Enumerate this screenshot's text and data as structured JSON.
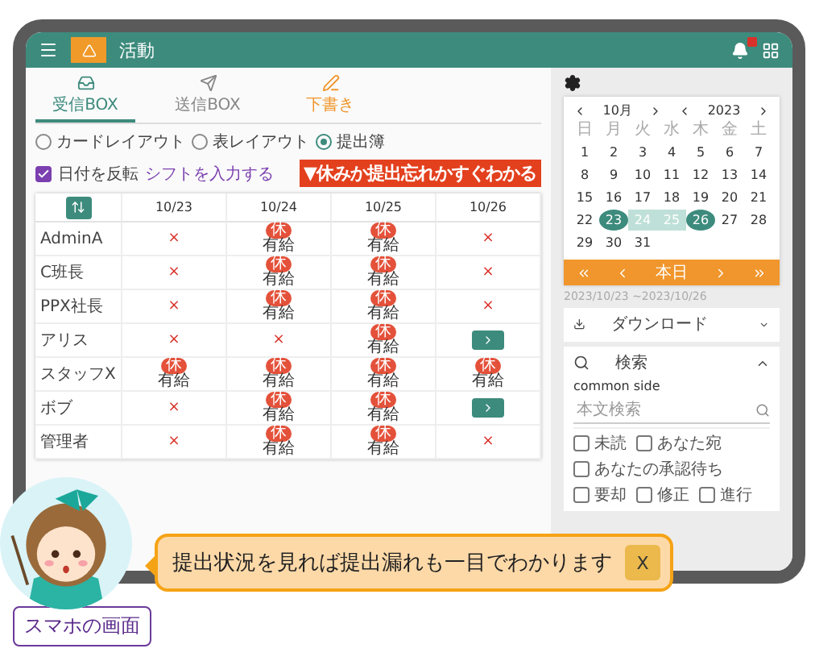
{
  "app_bar": {
    "title": "活動"
  },
  "tabs": [
    {
      "label": "受信BOX",
      "selected": true,
      "kind": "inbox"
    },
    {
      "label": "送信BOX",
      "selected": false,
      "kind": "outbox"
    },
    {
      "label": "下書き",
      "selected": false,
      "kind": "draft"
    }
  ],
  "layout_options": [
    {
      "label": "カードレイアウト",
      "selected": false
    },
    {
      "label": "表レイアウト",
      "selected": false
    },
    {
      "label": "提出簿",
      "selected": true
    }
  ],
  "reverse_dates": {
    "label": "日付を反転",
    "checked": true
  },
  "shift_link": "シフトを入力する",
  "banner": "▼休みか提出忘れかすぐわかる",
  "table": {
    "columns": [
      "10/23",
      "10/24",
      "10/25",
      "10/26"
    ],
    "rows": [
      {
        "name": "AdminA",
        "cells": [
          {
            "kind": "missing",
            "text": "×"
          },
          {
            "kind": "leave",
            "badge": "休",
            "label": "有給"
          },
          {
            "kind": "leave",
            "badge": "休",
            "label": "有給"
          },
          {
            "kind": "missing",
            "text": "×"
          }
        ]
      },
      {
        "name": "C班長",
        "cells": [
          {
            "kind": "missing",
            "text": "×"
          },
          {
            "kind": "leave",
            "badge": "休",
            "label": "有給"
          },
          {
            "kind": "leave",
            "badge": "休",
            "label": "有給"
          },
          {
            "kind": "missing",
            "text": "×"
          }
        ]
      },
      {
        "name": "PPX社長",
        "cells": [
          {
            "kind": "missing",
            "text": "×"
          },
          {
            "kind": "leave",
            "badge": "休",
            "label": "有給"
          },
          {
            "kind": "leave",
            "badge": "休",
            "label": "有給"
          },
          {
            "kind": "missing",
            "text": "×"
          }
        ]
      },
      {
        "name": "アリス",
        "cells": [
          {
            "kind": "missing",
            "text": "×"
          },
          {
            "kind": "missing",
            "text": "×"
          },
          {
            "kind": "leave",
            "badge": "休",
            "label": "有給"
          },
          {
            "kind": "action"
          }
        ]
      },
      {
        "name": "スタッフX",
        "cells": [
          {
            "kind": "leave",
            "badge": "休",
            "label": "有給"
          },
          {
            "kind": "leave",
            "badge": "休",
            "label": "有給"
          },
          {
            "kind": "leave",
            "badge": "休",
            "label": "有給"
          },
          {
            "kind": "leave",
            "badge": "休",
            "label": "有給"
          }
        ]
      },
      {
        "name": "ボブ",
        "cells": [
          {
            "kind": "missing",
            "text": "×"
          },
          {
            "kind": "leave",
            "badge": "休",
            "label": "有給"
          },
          {
            "kind": "leave",
            "badge": "休",
            "label": "有給"
          },
          {
            "kind": "action"
          }
        ]
      },
      {
        "name": "管理者",
        "cells": [
          {
            "kind": "missing",
            "text": "×"
          },
          {
            "kind": "leave",
            "badge": "休",
            "label": "有給"
          },
          {
            "kind": "leave",
            "badge": "休",
            "label": "有給"
          },
          {
            "kind": "missing",
            "text": "×"
          }
        ]
      }
    ]
  },
  "calendar": {
    "month": "10月",
    "year": "2023",
    "weekdays": [
      "日",
      "月",
      "火",
      "水",
      "木",
      "金",
      "土"
    ],
    "weeks": [
      [
        {
          "day": "1",
          "selected": false,
          "kind": "plain"
        },
        {
          "day": "2",
          "selected": false,
          "kind": "plain"
        },
        {
          "day": "3",
          "selected": false,
          "kind": "plain"
        },
        {
          "day": "4",
          "selected": false,
          "kind": "plain"
        },
        {
          "day": "5",
          "selected": false,
          "kind": "plain"
        },
        {
          "day": "6",
          "selected": false,
          "kind": "plain"
        },
        {
          "day": "7",
          "selected": false,
          "kind": "plain"
        }
      ],
      [
        {
          "day": "8",
          "selected": false,
          "kind": "plain"
        },
        {
          "day": "9",
          "selected": false,
          "kind": "plain"
        },
        {
          "day": "10",
          "selected": false,
          "kind": "plain"
        },
        {
          "day": "11",
          "selected": false,
          "kind": "plain"
        },
        {
          "day": "12",
          "selected": false,
          "kind": "plain"
        },
        {
          "day": "13",
          "selected": false,
          "kind": "plain"
        },
        {
          "day": "14",
          "selected": false,
          "kind": "plain"
        }
      ],
      [
        {
          "day": "15",
          "selected": false,
          "kind": "plain"
        },
        {
          "day": "16",
          "selected": false,
          "kind": "plain"
        },
        {
          "day": "17",
          "selected": false,
          "kind": "plain"
        },
        {
          "day": "18",
          "selected": false,
          "kind": "plain"
        },
        {
          "day": "19",
          "selected": false,
          "kind": "plain"
        },
        {
          "day": "20",
          "selected": false,
          "kind": "plain"
        },
        {
          "day": "21",
          "selected": false,
          "kind": "plain"
        }
      ],
      [
        {
          "day": "22",
          "selected": false,
          "kind": "plain"
        },
        {
          "day": "23",
          "selected": true,
          "kind": "edge"
        },
        {
          "day": "24",
          "selected": true,
          "kind": "inner"
        },
        {
          "day": "25",
          "selected": true,
          "kind": "inner"
        },
        {
          "day": "26",
          "selected": true,
          "kind": "edge"
        },
        {
          "day": "27",
          "selected": false,
          "kind": "plain"
        },
        {
          "day": "28",
          "selected": false,
          "kind": "plain"
        }
      ],
      [
        {
          "day": "29",
          "selected": false,
          "kind": "plain"
        },
        {
          "day": "30",
          "selected": false,
          "kind": "plain"
        },
        {
          "day": "31",
          "selected": false,
          "kind": "plain"
        }
      ]
    ],
    "today": "本日",
    "range": "2023/10/23 ~2023/10/26"
  },
  "download": {
    "label": "ダウンロード",
    "expanded": false
  },
  "search": {
    "label": "検索",
    "expanded": true,
    "scope": "common side",
    "placeholder": "本文検索",
    "filters": [
      {
        "label": "未読",
        "checked": false
      },
      {
        "label": "あなた宛",
        "checked": false
      },
      {
        "label": "あなたの承認待ち",
        "checked": false
      },
      {
        "label": "要却",
        "checked": false
      },
      {
        "label": "修正",
        "checked": false
      },
      {
        "label": "進行",
        "checked": false
      }
    ]
  },
  "tip": {
    "text": "提出状況を見れば提出漏れも一目でわかります",
    "close": "X"
  },
  "footer_button": "スマホの画面"
}
